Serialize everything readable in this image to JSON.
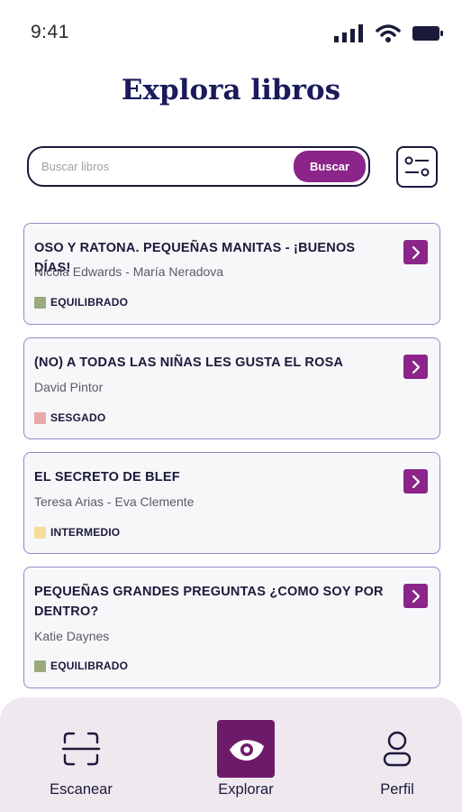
{
  "status_bar": {
    "time": "9:41",
    "icons": [
      "signal-icon",
      "wifi-icon",
      "battery-icon"
    ]
  },
  "header": {
    "title": "Explora libros"
  },
  "search": {
    "placeholder": "Buscar libros",
    "button_label": "Buscar",
    "filter_icon": "filter-icon"
  },
  "books": [
    {
      "title": "OSO Y RATONA. PEQUEÑAS MANITAS - ¡BUENOS DÍAS!",
      "author": "Nicola Edwards - María Neradova",
      "tag": "EQUILIBRADO",
      "tag_color": "#9aaa7e"
    },
    {
      "title": "(NO) A TODAS LAS NIÑAS LES GUSTA EL ROSA",
      "author": "David Pintor",
      "tag": "SESGADO",
      "tag_color": "#eaa9a8"
    },
    {
      "title": "EL SECRETO DE BLEF",
      "author": "Teresa Arias - Eva Clemente",
      "tag": "INTERMEDIO",
      "tag_color": "#f3df9a"
    },
    {
      "title": "PEQUEÑAS GRANDES PREGUNTAS ¿COMO SOY POR DENTRO?",
      "author": "Katie Daynes",
      "tag": "EQUILIBRADO",
      "tag_color": "#9aaa7e"
    }
  ],
  "colors": {
    "accent": "#8b2589",
    "accent_dark": "#6e1a6b",
    "title": "#1a1a5c",
    "nav_background": "#efe9ef"
  },
  "bottom_nav": {
    "items": [
      {
        "label": "Escanear",
        "icon": "scan-icon",
        "active": false
      },
      {
        "label": "Explorar",
        "icon": "eye-icon",
        "active": true
      },
      {
        "label": "Perfil",
        "icon": "user-icon",
        "active": false
      }
    ]
  }
}
